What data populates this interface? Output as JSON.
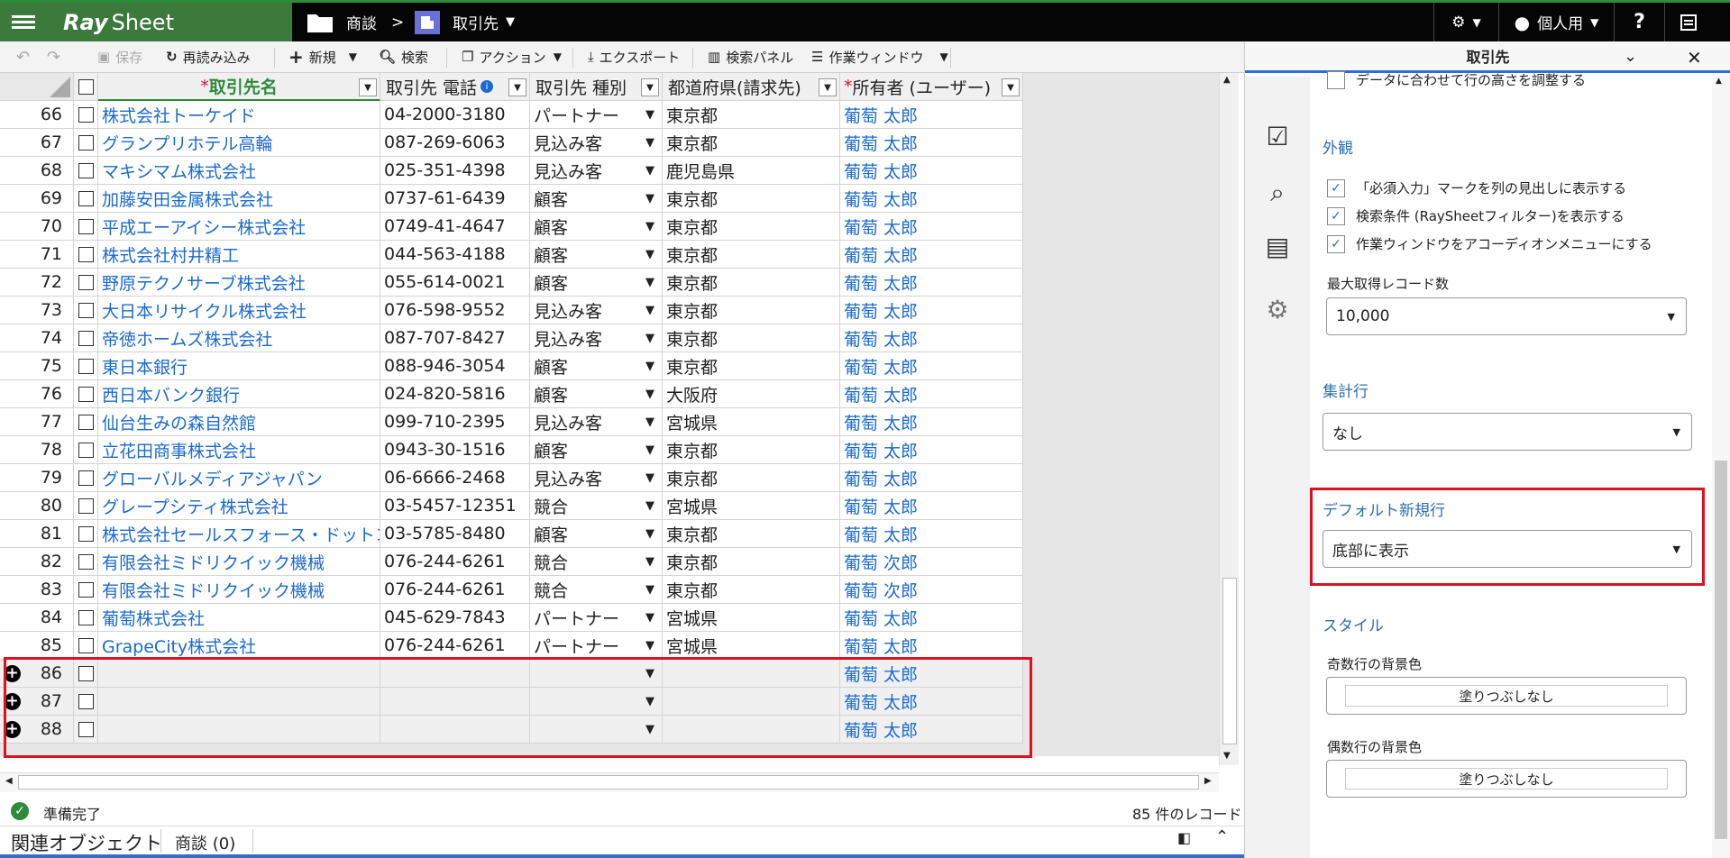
{
  "app": {
    "logo_ray": "Ray",
    "logo_sheet": "Sheet"
  },
  "header": {
    "crumb1": "商談",
    "crumb_sep": ">",
    "crumb2": "取引先",
    "user_label": "個人用",
    "help": "?"
  },
  "toolbar": {
    "save": "保存",
    "reload": "再読み込み",
    "new": "新規",
    "search": "検索",
    "action": "アクション",
    "export": "エクスポート",
    "search_panel": "検索パネル",
    "work_window": "作業ウィンドウ"
  },
  "grid": {
    "columns": [
      "取引先名",
      "取引先 電話",
      "取引先 種別",
      "都道府県(請求先)",
      "所有者 (ユーザー)"
    ],
    "required_mark": "*",
    "rows": [
      {
        "n": "66",
        "name": "株式会社トーケイド",
        "tel": "04-2000-3180",
        "type": "パートナー",
        "pref": "東京都",
        "owner": "葡萄 太郎"
      },
      {
        "n": "67",
        "name": "グランプリホテル高輪",
        "tel": "087-269-6063",
        "type": "見込み客",
        "pref": "東京都",
        "owner": "葡萄 太郎"
      },
      {
        "n": "68",
        "name": "マキシマム株式会社",
        "tel": "025-351-4398",
        "type": "見込み客",
        "pref": "鹿児島県",
        "owner": "葡萄 太郎"
      },
      {
        "n": "69",
        "name": "加藤安田金属株式会社",
        "tel": "0737-61-6439",
        "type": "顧客",
        "pref": "東京都",
        "owner": "葡萄 太郎"
      },
      {
        "n": "70",
        "name": "平成エーアイシー株式会社",
        "tel": "0749-41-4647",
        "type": "顧客",
        "pref": "東京都",
        "owner": "葡萄 太郎"
      },
      {
        "n": "71",
        "name": "株式会社村井精工",
        "tel": "044-563-4188",
        "type": "顧客",
        "pref": "東京都",
        "owner": "葡萄 太郎"
      },
      {
        "n": "72",
        "name": "野原テクノサーブ株式会社",
        "tel": "055-614-0021",
        "type": "顧客",
        "pref": "東京都",
        "owner": "葡萄 太郎"
      },
      {
        "n": "73",
        "name": "大日本リサイクル株式会社",
        "tel": "076-598-9552",
        "type": "見込み客",
        "pref": "東京都",
        "owner": "葡萄 太郎"
      },
      {
        "n": "74",
        "name": "帝徳ホームズ株式会社",
        "tel": "087-707-8427",
        "type": "見込み客",
        "pref": "東京都",
        "owner": "葡萄 太郎"
      },
      {
        "n": "75",
        "name": "東日本銀行",
        "tel": "088-946-3054",
        "type": "顧客",
        "pref": "東京都",
        "owner": "葡萄 太郎"
      },
      {
        "n": "76",
        "name": "西日本バンク銀行",
        "tel": "024-820-5816",
        "type": "顧客",
        "pref": "大阪府",
        "owner": "葡萄 太郎"
      },
      {
        "n": "77",
        "name": "仙台生みの森自然館",
        "tel": "099-710-2395",
        "type": "見込み客",
        "pref": "宮城県",
        "owner": "葡萄 太郎"
      },
      {
        "n": "78",
        "name": "立花田商事株式会社",
        "tel": "0943-30-1516",
        "type": "顧客",
        "pref": "東京都",
        "owner": "葡萄 太郎"
      },
      {
        "n": "79",
        "name": "グローバルメディアジャパン",
        "tel": "06-6666-2468",
        "type": "見込み客",
        "pref": "東京都",
        "owner": "葡萄 太郎"
      },
      {
        "n": "80",
        "name": "グレープシティ株式会社",
        "tel": "03-5457-12351",
        "type": "競合",
        "pref": "宮城県",
        "owner": "葡萄 太郎"
      },
      {
        "n": "81",
        "name": "株式会社セールスフォース・ドットコム",
        "tel": "03-5785-8480",
        "type": "顧客",
        "pref": "東京都",
        "owner": "葡萄 太郎"
      },
      {
        "n": "82",
        "name": "有限会社ミドリクイック機械",
        "tel": "076-244-6261",
        "type": "競合",
        "pref": "東京都",
        "owner": "葡萄 次郎"
      },
      {
        "n": "83",
        "name": "有限会社ミドリクイック機械",
        "tel": "076-244-6261",
        "type": "競合",
        "pref": "東京都",
        "owner": "葡萄 次郎"
      },
      {
        "n": "84",
        "name": "葡萄株式会社",
        "tel": "045-629-7843",
        "type": "パートナー",
        "pref": "宮城県",
        "owner": "葡萄 太郎"
      },
      {
        "n": "85",
        "name": "GrapeCity株式会社",
        "tel": "076-244-6261",
        "type": "パートナー",
        "pref": "宮城県",
        "owner": "葡萄 太郎"
      }
    ],
    "new_rows": [
      {
        "n": "86",
        "owner": "葡萄 太郎"
      },
      {
        "n": "87",
        "owner": "葡萄 太郎"
      },
      {
        "n": "88",
        "owner": "葡萄 太郎"
      }
    ]
  },
  "status": {
    "ready": "準備完了",
    "count": "85 件のレコード",
    "related": "関連オブジェクト",
    "deals_tab": "商談 (0)"
  },
  "panel": {
    "title": "取引先",
    "adjust_height": "データに合わせて行の高さを調整する",
    "appearance": "外観",
    "opt1": "「必須入力」マークを列の見出しに表示する",
    "opt2": "検索条件 (RaySheetフィルター)を表示する",
    "opt3": "作業ウィンドウをアコーディオンメニューにする",
    "max_records_label": "最大取得レコード数",
    "max_records_value": "10,000",
    "summary_row": "集計行",
    "summary_value": "なし",
    "default_new_row": "デフォルト新規行",
    "default_new_row_value": "底部に表示",
    "style": "スタイル",
    "odd_bg": "奇数行の背景色",
    "odd_bg_value": "塗りつぶしなし",
    "even_bg": "偶数行の背景色",
    "even_bg_value": "塗りつぶしなし"
  }
}
